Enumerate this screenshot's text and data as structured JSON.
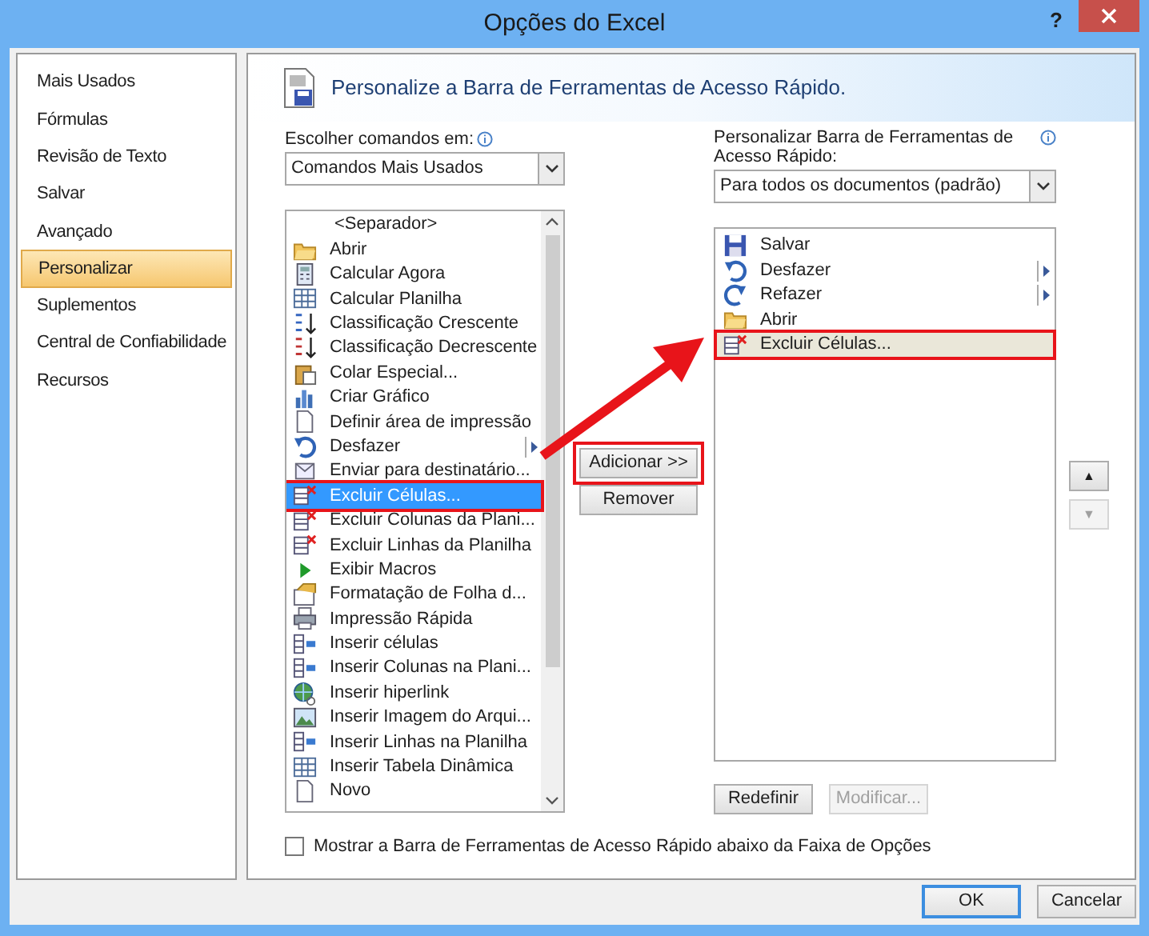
{
  "window": {
    "title": "Opções do Excel",
    "help": "?"
  },
  "sidebar": {
    "items": [
      {
        "label": "Mais Usados",
        "selected": false
      },
      {
        "label": "Fórmulas",
        "selected": false
      },
      {
        "label": "Revisão de Texto",
        "selected": false
      },
      {
        "label": "Salvar",
        "selected": false
      },
      {
        "label": "Avançado",
        "selected": false
      },
      {
        "label": "Personalizar",
        "selected": true
      },
      {
        "label": "Suplementos",
        "selected": false
      },
      {
        "label": "Central de Confiabilidade",
        "selected": false
      },
      {
        "label": "Recursos",
        "selected": false
      }
    ]
  },
  "header": {
    "title": "Personalize a Barra de Ferramentas de Acesso Rápido."
  },
  "choose_commands": {
    "label": "Escolher comandos em:",
    "value": "Comandos Mais Usados"
  },
  "commands": [
    {
      "label": "<Separador>",
      "kind": "separator",
      "selected": false,
      "submenu": false,
      "highlighted": false
    },
    {
      "label": "Abrir",
      "kind": "folder",
      "selected": false,
      "submenu": false,
      "highlighted": false
    },
    {
      "label": "Calcular Agora",
      "kind": "calculator",
      "selected": false,
      "submenu": false,
      "highlighted": false
    },
    {
      "label": "Calcular Planilha",
      "kind": "sheet",
      "selected": false,
      "submenu": false,
      "highlighted": false
    },
    {
      "label": "Classificação Crescente",
      "kind": "sort-asc",
      "selected": false,
      "submenu": false,
      "highlighted": false
    },
    {
      "label": "Classificação Decrescente",
      "kind": "sort-desc",
      "selected": false,
      "submenu": false,
      "highlighted": false
    },
    {
      "label": "Colar Especial...",
      "kind": "paste",
      "selected": false,
      "submenu": false,
      "highlighted": false
    },
    {
      "label": "Criar Gráfico",
      "kind": "chart",
      "selected": false,
      "submenu": false,
      "highlighted": false
    },
    {
      "label": "Definir área de impressão",
      "kind": "page",
      "selected": false,
      "submenu": false,
      "highlighted": false
    },
    {
      "label": "Desfazer",
      "kind": "undo",
      "selected": false,
      "submenu": true,
      "highlighted": false
    },
    {
      "label": "Enviar para destinatário...",
      "kind": "send",
      "selected": false,
      "submenu": false,
      "highlighted": false
    },
    {
      "label": "Excluir Células...",
      "kind": "delete",
      "selected": true,
      "submenu": false,
      "highlighted": true
    },
    {
      "label": "Excluir Colunas da Plani...",
      "kind": "delete",
      "selected": false,
      "submenu": false,
      "highlighted": false
    },
    {
      "label": "Excluir Linhas da Planilha",
      "kind": "delete",
      "selected": false,
      "submenu": false,
      "highlighted": false
    },
    {
      "label": "Exibir Macros",
      "kind": "play",
      "selected": false,
      "submenu": false,
      "highlighted": false
    },
    {
      "label": "Formatação de Folha d...",
      "kind": "format",
      "selected": false,
      "submenu": false,
      "highlighted": false
    },
    {
      "label": "Impressão Rápida",
      "kind": "printer",
      "selected": false,
      "submenu": false,
      "highlighted": false
    },
    {
      "label": "Inserir células",
      "kind": "insert",
      "selected": false,
      "submenu": false,
      "highlighted": false
    },
    {
      "label": "Inserir Colunas na Plani...",
      "kind": "insert",
      "selected": false,
      "submenu": false,
      "highlighted": false
    },
    {
      "label": "Inserir hiperlink",
      "kind": "globe",
      "selected": false,
      "submenu": false,
      "highlighted": false
    },
    {
      "label": "Inserir Imagem do Arqui...",
      "kind": "image",
      "selected": false,
      "submenu": false,
      "highlighted": false
    },
    {
      "label": "Inserir Linhas na Planilha",
      "kind": "insert",
      "selected": false,
      "submenu": false,
      "highlighted": false
    },
    {
      "label": "Inserir Tabela Dinâmica",
      "kind": "sheet",
      "selected": false,
      "submenu": false,
      "highlighted": false
    },
    {
      "label": "Novo",
      "kind": "page",
      "selected": false,
      "submenu": false,
      "highlighted": false
    }
  ],
  "customize": {
    "label": "Personalizar Barra de Ferramentas de Acesso Rápido:",
    "value": "Para todos os documentos (padrão)"
  },
  "toolbar_items": [
    {
      "label": "Salvar",
      "kind": "save",
      "selected": false,
      "submenu": false,
      "highlighted": false
    },
    {
      "label": "Desfazer",
      "kind": "undo",
      "selected": false,
      "submenu": true,
      "highlighted": false
    },
    {
      "label": "Refazer",
      "kind": "redo",
      "selected": false,
      "submenu": true,
      "highlighted": false
    },
    {
      "label": "Abrir",
      "kind": "folder",
      "selected": false,
      "submenu": false,
      "highlighted": false
    },
    {
      "label": "Excluir Células...",
      "kind": "delete",
      "selected": true,
      "submenu": false,
      "highlighted": true
    }
  ],
  "transfer_buttons": [
    {
      "label": "Adicionar >>",
      "highlighted": true
    },
    {
      "label": "Remover",
      "highlighted": false
    }
  ],
  "list_buttons": [
    {
      "label": "Redefinir",
      "disabled": false
    },
    {
      "label": "Modificar...",
      "disabled": true
    }
  ],
  "move_buttons": [
    {
      "label": "▲",
      "disabled": false
    },
    {
      "label": "▼",
      "disabled": true
    }
  ],
  "checkbox": {
    "label": "Mostrar a Barra de Ferramentas de Acesso Rápido abaixo da Faixa de Opções",
    "checked": false
  },
  "footer_buttons": [
    {
      "label": "OK",
      "default": true
    },
    {
      "label": "Cancelar",
      "default": false
    }
  ]
}
